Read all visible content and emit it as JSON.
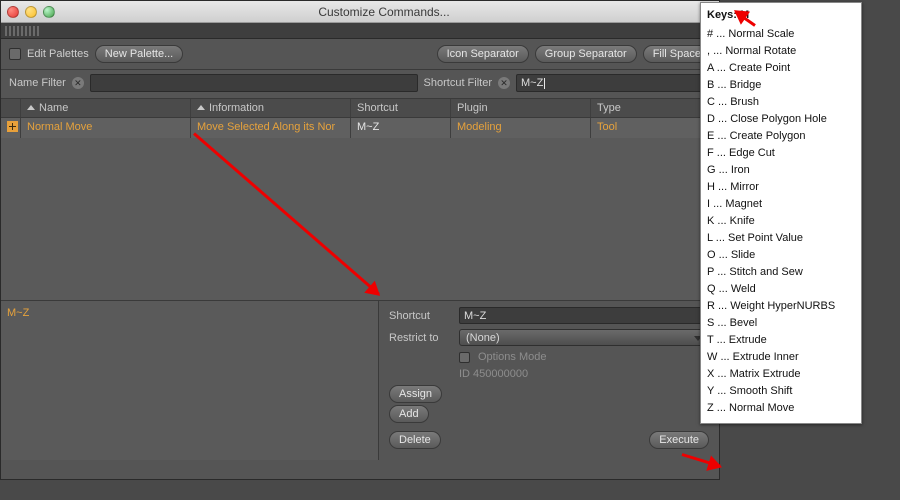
{
  "window": {
    "title": "Customize Commands..."
  },
  "toolbar": {
    "edit_palettes": "Edit Palettes",
    "new_palette": "New Palette...",
    "icon_separator": "Icon Separator",
    "group_separator": "Group Separator",
    "fill_space": "Fill Space"
  },
  "filters": {
    "name_label": "Name Filter",
    "name_value": "",
    "shortcut_label": "Shortcut Filter",
    "shortcut_value": "M~Z"
  },
  "table": {
    "headers": {
      "name": "Name",
      "info": "Information",
      "shortcut": "Shortcut",
      "plugin": "Plugin",
      "type": "Type"
    },
    "rows": [
      {
        "name": "Normal Move",
        "info": "Move Selected Along its Nor",
        "shortcut": "M~Z",
        "plugin": "Modeling",
        "type": "Tool"
      }
    ]
  },
  "detail": {
    "label_value": "M~Z",
    "shortcut_label": "Shortcut",
    "shortcut_value": "M~Z",
    "restrict_label": "Restrict to",
    "restrict_value": "(None)",
    "options_mode": "Options Mode",
    "id_text": "ID 450000000",
    "assign": "Assign",
    "add": "Add",
    "delete": "Delete",
    "execute": "Execute"
  },
  "popup": {
    "header": "Keys: M",
    "items": [
      {
        "k": "#",
        "cmd": "Normal Scale"
      },
      {
        "k": ",",
        "cmd": "Normal Rotate"
      },
      {
        "k": "A",
        "cmd": "Create Point"
      },
      {
        "k": "B",
        "cmd": "Bridge"
      },
      {
        "k": "C",
        "cmd": "Brush"
      },
      {
        "k": "D",
        "cmd": "Close Polygon Hole"
      },
      {
        "k": "E",
        "cmd": "Create Polygon"
      },
      {
        "k": "F",
        "cmd": "Edge Cut"
      },
      {
        "k": "G",
        "cmd": "Iron"
      },
      {
        "k": "H",
        "cmd": "Mirror"
      },
      {
        "k": "I",
        "cmd": "Magnet"
      },
      {
        "k": "K",
        "cmd": "Knife"
      },
      {
        "k": "L",
        "cmd": "Set Point Value"
      },
      {
        "k": "O",
        "cmd": "Slide"
      },
      {
        "k": "P",
        "cmd": "Stitch and Sew"
      },
      {
        "k": "Q",
        "cmd": "Weld"
      },
      {
        "k": "R",
        "cmd": "Weight HyperNURBS"
      },
      {
        "k": "S",
        "cmd": "Bevel"
      },
      {
        "k": "T",
        "cmd": "Extrude"
      },
      {
        "k": "W",
        "cmd": "Extrude Inner"
      },
      {
        "k": "X",
        "cmd": "Matrix Extrude"
      },
      {
        "k": "Y",
        "cmd": "Smooth Shift"
      },
      {
        "k": "Z",
        "cmd": "Normal Move"
      }
    ]
  }
}
